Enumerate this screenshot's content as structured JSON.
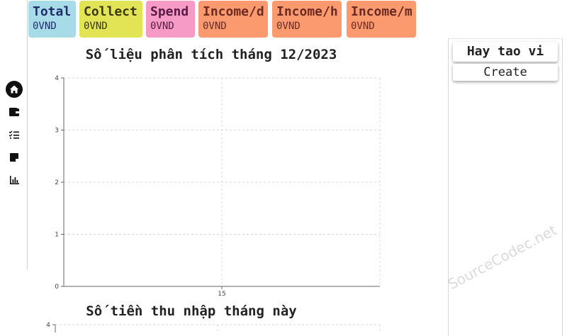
{
  "cards": [
    {
      "label": "Total",
      "value": "0VND",
      "bg": "#a8dbe8",
      "color": "#1f2f6b"
    },
    {
      "label": "Collect",
      "value": "0VND",
      "bg": "#e3e356",
      "color": "#3a3a10"
    },
    {
      "label": "Spend",
      "value": "0VND",
      "bg": "#f59bc6",
      "color": "#5a1a47"
    },
    {
      "label": "Income/d",
      "value": "0VND",
      "bg": "#fc9a6f",
      "color": "#6b2a22"
    },
    {
      "label": "Income/h",
      "value": "0VND",
      "bg": "#fc9a6f",
      "color": "#6b2a22"
    },
    {
      "label": "Income/m",
      "value": "0VND",
      "bg": "#fc9a6f",
      "color": "#6b2a22"
    }
  ],
  "sidebar": {
    "icons": [
      "home-icon",
      "wallet-icon",
      "checklist-icon",
      "note-icon",
      "bar-chart-icon"
    ]
  },
  "chart_data": [
    {
      "type": "line",
      "title": "Số liệu phân tích tháng 12/2023",
      "x": [
        "15"
      ],
      "yticks": [
        0,
        1,
        2,
        3,
        4
      ],
      "ylim": [
        0,
        4
      ],
      "series": [],
      "grid": true
    },
    {
      "type": "line",
      "title": "Số tiền thu nhập tháng này",
      "yticks": [
        4
      ],
      "ylim": [
        0,
        4
      ],
      "series": [],
      "grid": true
    }
  ],
  "right_panel": {
    "title": "Hay tao vi",
    "create_label": "Create"
  },
  "watermark": "SourceCodec.net"
}
